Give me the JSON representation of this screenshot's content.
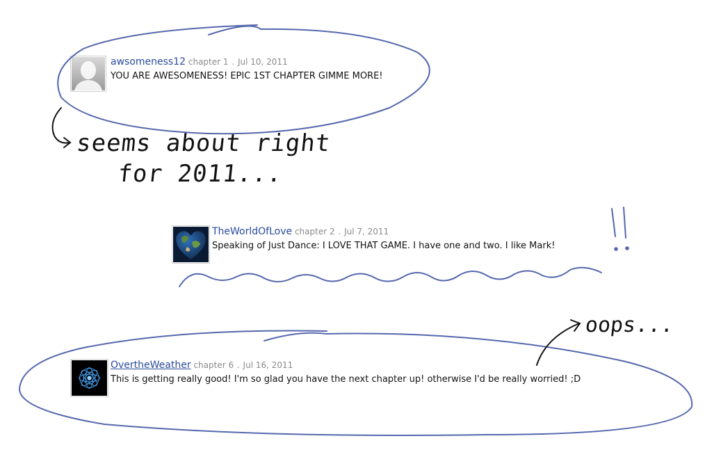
{
  "comments": [
    {
      "username": "awsomeness12",
      "chapter": "chapter 1",
      "date": "Jul 10, 2011",
      "text": "YOU ARE AWESOMENESS! EPIC 1ST CHAPTER GIMME MORE!",
      "avatar_icon": "default-silhouette-avatar"
    },
    {
      "username": "TheWorldOfLove",
      "chapter": "chapter 2",
      "date": "Jul 7, 2011",
      "text": "Speaking of Just Dance: I LOVE THAT GAME. I have one and two. I like Mark!",
      "avatar_icon": "heart-globe-avatar"
    },
    {
      "username": "OvertheWeather",
      "chapter": "chapter 6",
      "date": "Jul 16, 2011",
      "text": "This is getting really good! I'm so glad you have the next chapter up! otherwise I'd be really worried! ;D",
      "avatar_icon": "blue-mandala-avatar"
    }
  ],
  "annotations": {
    "note1_line1": "seems about right",
    "note1_line2": "for 2011...",
    "note2": "!!",
    "note3": "oops..."
  },
  "colors": {
    "ink_blue": "#5467ad",
    "username_blue": "#2a4a9b",
    "handwriting": "#111111"
  }
}
